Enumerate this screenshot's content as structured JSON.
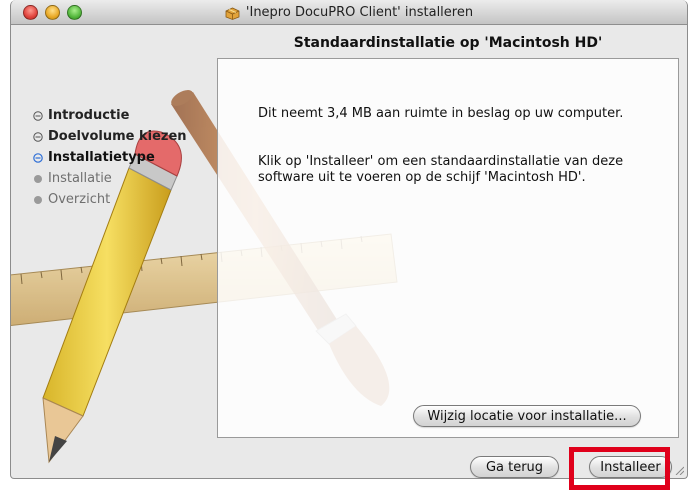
{
  "window": {
    "title": "'Inepro DocuPRO Client' installeren",
    "title_icon": "package-icon",
    "controls": [
      "close-button",
      "minimize-button",
      "zoom-button"
    ]
  },
  "heading": "Standaardinstallatie op 'Macintosh HD'",
  "steps": [
    {
      "label": "Introductie",
      "state": "done"
    },
    {
      "label": "Doelvolume kiezen",
      "state": "done"
    },
    {
      "label": "Installatietype",
      "state": "current"
    },
    {
      "label": "Installatie",
      "state": "future"
    },
    {
      "label": "Overzicht",
      "state": "future"
    }
  ],
  "content": {
    "paragraph1": "Dit neemt 3,4 MB aan ruimte in beslag op uw computer.",
    "paragraph2": "Klik op 'Installeer' om een standaardinstallatie van deze software uit te voeren op de schijf 'Macintosh HD'.",
    "change_location_label": "Wijzig locatie voor installatie..."
  },
  "buttons": {
    "back_label": "Ga terug",
    "install_label": "Installeer"
  },
  "colors": {
    "highlight": "#e0001b",
    "current_step_bullet": "#2f6fd6"
  }
}
